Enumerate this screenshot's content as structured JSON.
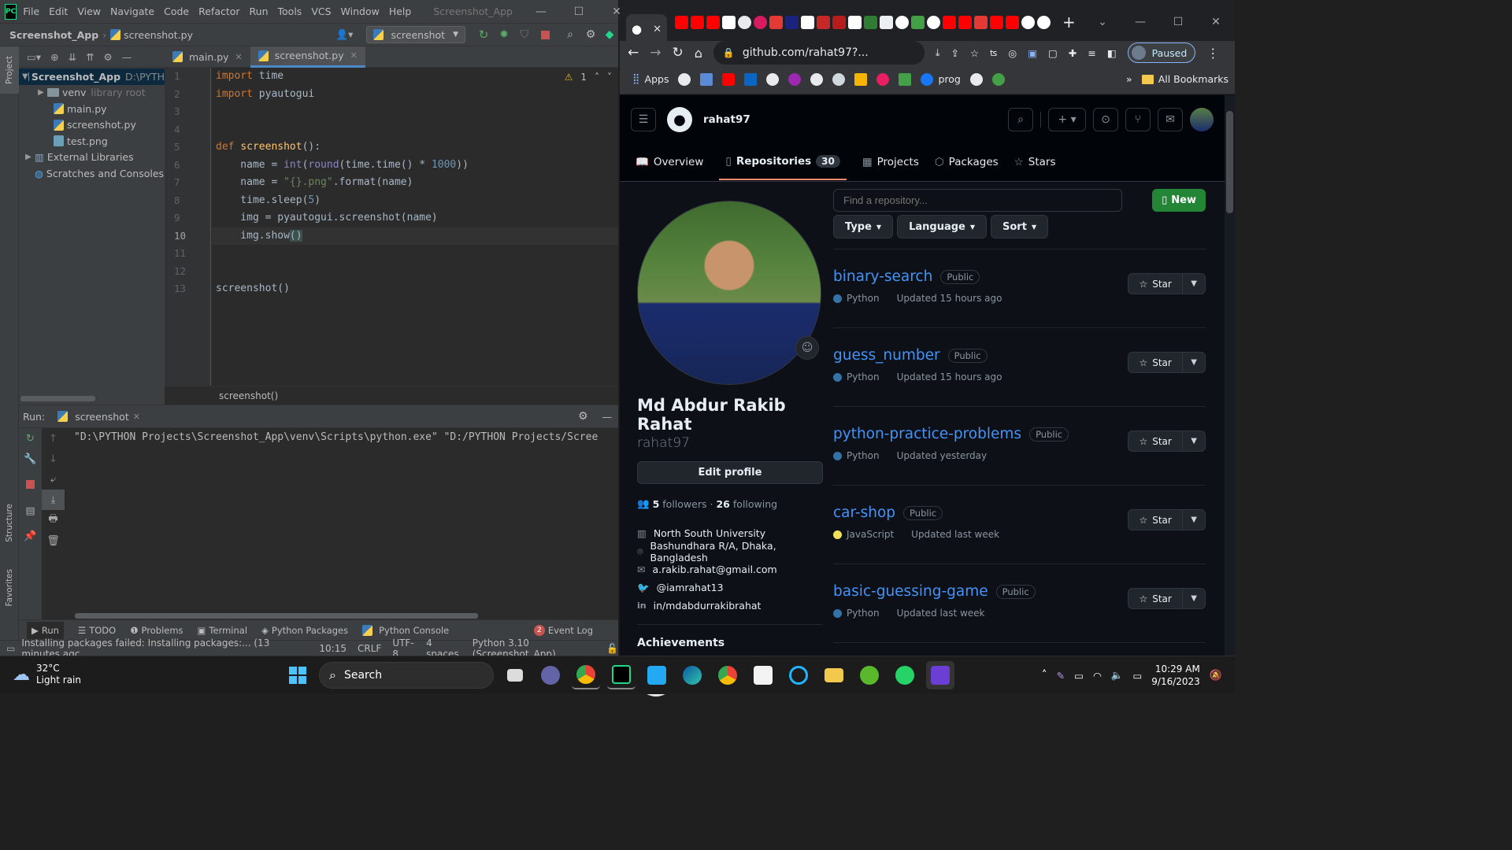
{
  "ide": {
    "window_title": "Screenshot_App",
    "menu": [
      "File",
      "Edit",
      "View",
      "Navigate",
      "Code",
      "Refactor",
      "Run",
      "Tools",
      "VCS",
      "Window",
      "Help"
    ],
    "breadcrumb_project": "Screenshot_App",
    "breadcrumb_file": "screenshot.py",
    "run_config": "screenshot",
    "project_label": "Project",
    "tree": [
      {
        "name": "Screenshot_App",
        "hint": "D:\\PYTH",
        "type": "folder",
        "depth": 0,
        "expanded": true
      },
      {
        "name": "venv",
        "hint": "library root",
        "type": "folder",
        "depth": 1,
        "expanded": false
      },
      {
        "name": "main.py",
        "hint": "",
        "type": "py",
        "depth": 1
      },
      {
        "name": "screenshot.py",
        "hint": "",
        "type": "py",
        "depth": 1
      },
      {
        "name": "test.png",
        "hint": "",
        "type": "png",
        "depth": 1
      },
      {
        "name": "External Libraries",
        "hint": "",
        "type": "lib",
        "depth": 0
      },
      {
        "name": "Scratches and Consoles",
        "hint": "",
        "type": "scratch",
        "depth": 0
      }
    ],
    "tabs": [
      {
        "label": "main.py"
      },
      {
        "label": "screenshot.py"
      }
    ],
    "warnings": "1",
    "line_numbers": [
      "1",
      "2",
      "3",
      "4",
      "5",
      "6",
      "7",
      "8",
      "9",
      "10",
      "11",
      "12",
      "13"
    ],
    "code_breadcrumb": "screenshot()",
    "run_label": "Run:",
    "run_tab": "screenshot",
    "console_line": "\"D:\\PYTHON Projects\\Screenshot_App\\venv\\Scripts\\python.exe\" \"D:/PYTHON Projects/Scree",
    "bottom_tabs": [
      "Run",
      "TODO",
      "Problems",
      "Terminal",
      "Python Packages",
      "Python Console"
    ],
    "event_log": "Event Log",
    "event_count": "2",
    "status": {
      "message": "Installing packages failed: Installing packages:... (13 minutes agc",
      "position": "10:15",
      "line_sep": "CRLF",
      "encoding": "UTF-8",
      "indent": "4 spaces",
      "interpreter": "Python 3.10 (Screenshot_App)"
    },
    "side_labels": {
      "structure": "Structure",
      "favorites": "Favorites"
    }
  },
  "browser": {
    "url": "github.com/rahat97?...",
    "paused": "Paused",
    "bookmarks": {
      "apps": "Apps",
      "prog": "prog",
      "all": "All Bookmarks"
    },
    "gh": {
      "username": "rahat97",
      "nav": [
        {
          "label": "Overview"
        },
        {
          "label": "Repositories",
          "count": "30"
        },
        {
          "label": "Projects"
        },
        {
          "label": "Packages"
        },
        {
          "label": "Stars"
        }
      ],
      "find_placeholder": "Find a repository...",
      "filters": [
        "Type",
        "Language",
        "Sort"
      ],
      "new_label": "New",
      "full_name": "Md Abdur Rakib Rahat",
      "login": "rahat97",
      "edit_profile": "Edit profile",
      "followers_count": "5",
      "followers_label": "followers",
      "following_count": "26",
      "following_label": "following",
      "details": [
        {
          "icon": "org-icon",
          "text": "North South University"
        },
        {
          "icon": "location-icon",
          "text": "Bashundhara R/A, Dhaka, Bangladesh"
        },
        {
          "icon": "mail-icon",
          "text": "a.rakib.rahat@gmail.com"
        },
        {
          "icon": "twitter-icon",
          "text": "@iamrahat13"
        },
        {
          "icon": "linkedin-icon",
          "text": "in/mdabdurrakibrahat"
        }
      ],
      "achievements": "Achievements",
      "repos": [
        {
          "name": "binary-search",
          "visibility": "Public",
          "language": "Python",
          "lang_color": "#3572A5",
          "updated": "Updated 15 hours ago"
        },
        {
          "name": "guess_number",
          "visibility": "Public",
          "language": "Python",
          "lang_color": "#3572A5",
          "updated": "Updated 15 hours ago"
        },
        {
          "name": "python-practice-problems",
          "visibility": "Public",
          "language": "Python",
          "lang_color": "#3572A5",
          "updated": "Updated yesterday"
        },
        {
          "name": "car-shop",
          "visibility": "Public",
          "language": "JavaScript",
          "lang_color": "#f1e05a",
          "updated": "Updated last week"
        },
        {
          "name": "basic-guessing-game",
          "visibility": "Public",
          "language": "Python",
          "lang_color": "#3572A5",
          "updated": "Updated last week"
        }
      ],
      "star_label": "Star"
    }
  },
  "taskbar": {
    "temp": "32°C",
    "weather": "Light rain",
    "search": "Search",
    "time": "10:29 AM",
    "date": "9/16/2023"
  }
}
